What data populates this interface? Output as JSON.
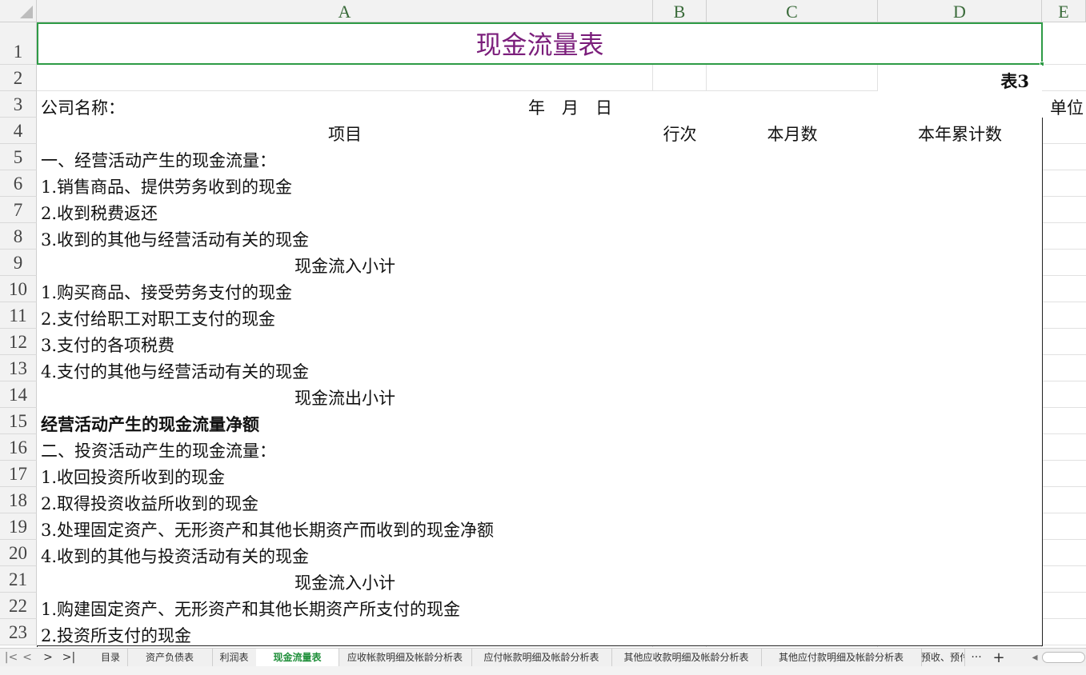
{
  "columns": [
    "A",
    "B",
    "C",
    "D",
    "E"
  ],
  "rows": [
    "1",
    "2",
    "3",
    "4",
    "5",
    "6",
    "7",
    "8",
    "9",
    "10",
    "11",
    "12",
    "13",
    "14",
    "15",
    "16",
    "17",
    "18",
    "19",
    "20",
    "21",
    "22",
    "23"
  ],
  "title": "现金流量表",
  "table_no": "表3",
  "company_label": "公司名称：",
  "date_label": "年　月　日",
  "unit_label": "单位",
  "headers": {
    "item": "项目",
    "line_no": "行次",
    "month": "本月数",
    "year_total": "本年累计数"
  },
  "items": [
    {
      "text": "一、经营活动产生的现金流量：",
      "align": "left",
      "bold": false
    },
    {
      "text": "1.销售商品、提供劳务收到的现金",
      "align": "left",
      "bold": false
    },
    {
      "text": "2.收到税费返还",
      "align": "left",
      "bold": false
    },
    {
      "text": "3.收到的其他与经营活动有关的现金",
      "align": "left",
      "bold": false
    },
    {
      "text": "现金流入小计",
      "align": "center",
      "bold": false
    },
    {
      "text": "1.购买商品、接受劳务支付的现金",
      "align": "left",
      "bold": false
    },
    {
      "text": "2.支付给职工对职工支付的现金",
      "align": "left",
      "bold": false
    },
    {
      "text": "3.支付的各项税费",
      "align": "left",
      "bold": false
    },
    {
      "text": "4.支付的其他与经营活动有关的现金",
      "align": "left",
      "bold": false
    },
    {
      "text": "现金流出小计",
      "align": "center",
      "bold": false
    },
    {
      "text": "经营活动产生的现金流量净额",
      "align": "left",
      "bold": true
    },
    {
      "text": "二、投资活动产生的现金流量：",
      "align": "left",
      "bold": false
    },
    {
      "text": "1.收回投资所收到的现金",
      "align": "left",
      "bold": false
    },
    {
      "text": "2.取得投资收益所收到的现金",
      "align": "left",
      "bold": false
    },
    {
      "text": "3.处理固定资产、无形资产和其他长期资产而收到的现金净额",
      "align": "left",
      "bold": false
    },
    {
      "text": "4.收到的其他与投资活动有关的现金",
      "align": "left",
      "bold": false
    },
    {
      "text": "现金流入小计",
      "align": "center",
      "bold": false
    },
    {
      "text": "1.购建固定资产、无形资产和其他长期资产所支付的现金",
      "align": "left",
      "bold": false
    },
    {
      "text": "2.投资所支付的现金",
      "align": "left",
      "bold": false
    }
  ],
  "sheet_tabs": [
    "目录",
    "资产负债表",
    "利润表",
    "现金流量表",
    "应收帐款明细及帐龄分析表",
    "应付帐款明细及帐龄分析表",
    "其他应收款明细及帐龄分析表",
    "其他应付款明细及帐龄分析表",
    "预收、预付"
  ],
  "active_tab": "现金流量表",
  "nav": {
    "first": "|<",
    "prev": "<",
    "next": ">",
    "last": ">|",
    "more": "···",
    "add": "+"
  },
  "colors": {
    "title": "#7b1e7b",
    "selection": "#2e9b46",
    "active_tab": "#1f8f3a"
  }
}
